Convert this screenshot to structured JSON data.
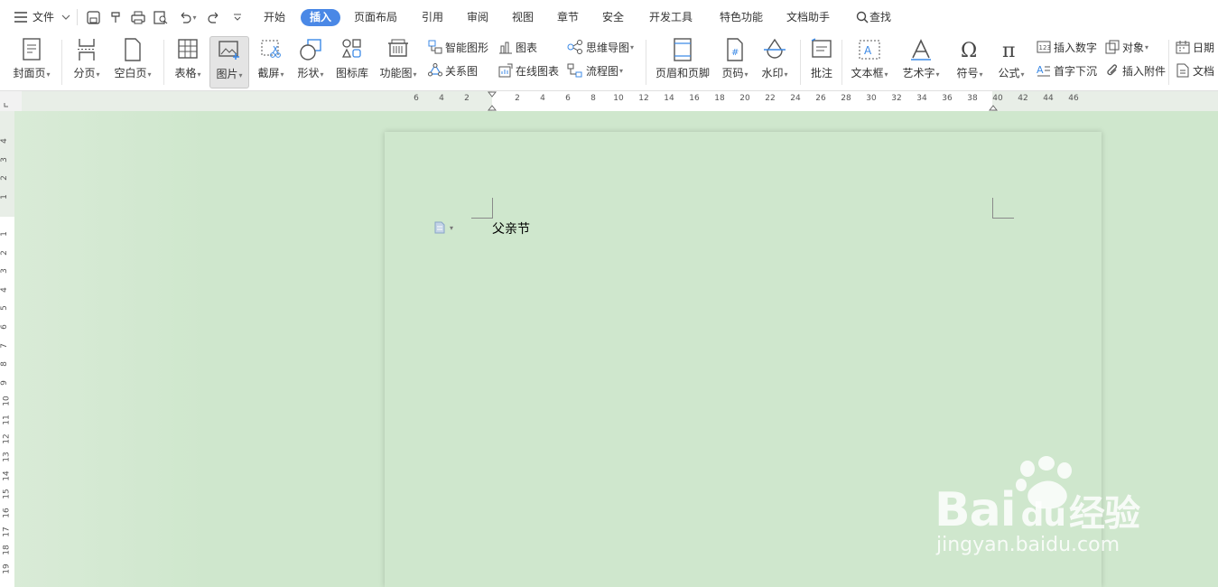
{
  "menubar": {
    "file": "文件",
    "tabs": [
      "开始",
      "插入",
      "页面布局",
      "引用",
      "审阅",
      "视图",
      "章节",
      "安全",
      "开发工具",
      "特色功能",
      "文档助手"
    ],
    "active_tab": "插入",
    "search": "查找"
  },
  "ribbon": {
    "cover_page": "封面页",
    "page_break": "分页",
    "blank_page": "空白页",
    "table": "表格",
    "picture": "图片",
    "screenshot": "截屏",
    "shapes": "形状",
    "icon_library": "图标库",
    "function_chart": "功能图",
    "smart_art": "智能图形",
    "chart": "图表",
    "mind_map": "思维导图",
    "relation_chart": "关系图",
    "online_chart": "在线图表",
    "flow_chart": "流程图",
    "header_footer": "页眉和页脚",
    "page_number": "页码",
    "watermark": "水印",
    "comment": "批注",
    "text_box": "文本框",
    "word_art": "艺术字",
    "symbol": "符号",
    "formula": "公式",
    "insert_number": "插入数字",
    "drop_cap": "首字下沉",
    "object": "对象",
    "attachment": "插入附件",
    "date": "日期",
    "doc_part": "文档"
  },
  "ruler": {
    "h_left": [
      "6",
      "4",
      "2"
    ],
    "h_right": [
      "2",
      "4",
      "6",
      "8",
      "10",
      "12",
      "14",
      "16",
      "18",
      "20",
      "22",
      "24",
      "26",
      "28",
      "30",
      "32",
      "34",
      "36",
      "38",
      "40",
      "42",
      "44",
      "46"
    ],
    "v_top": [
      "4",
      "3",
      "2",
      "1"
    ],
    "v_bottom": [
      "1",
      "2",
      "3",
      "4",
      "5",
      "6",
      "7",
      "8",
      "9",
      "10",
      "11",
      "12",
      "13",
      "14",
      "15",
      "16",
      "17",
      "18",
      "19"
    ]
  },
  "document": {
    "text": "父亲节"
  },
  "watermark": {
    "brand": "Bai",
    "brand2": "du",
    "cn": "经验",
    "url": "jingyan.baidu.com"
  },
  "colors": {
    "accent": "#4a88e6",
    "page_bg": "#cfe7cd"
  }
}
